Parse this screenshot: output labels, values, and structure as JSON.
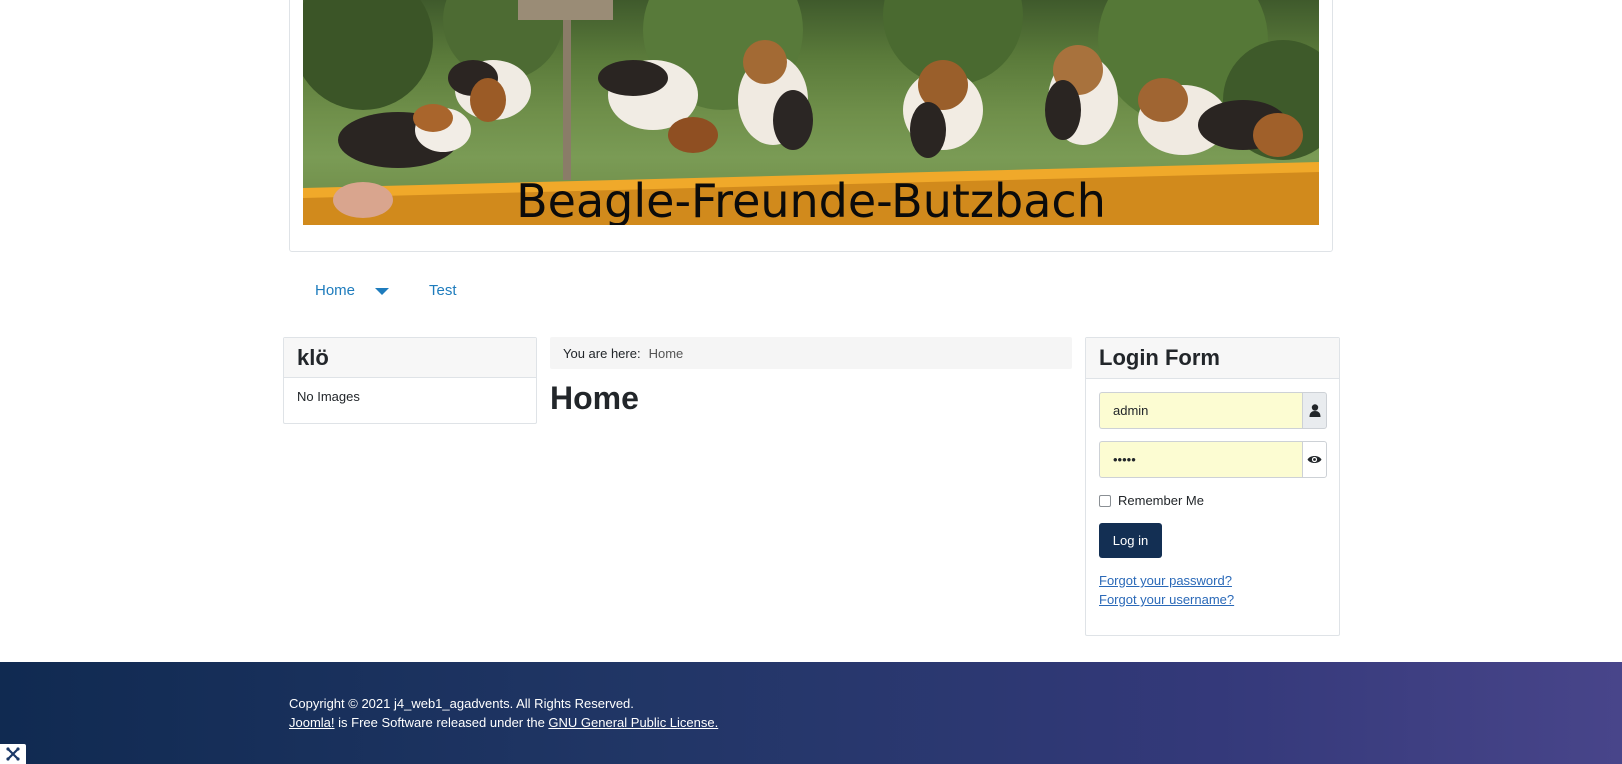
{
  "header": {
    "banner_title": "Beagle-Freunde-Butzbach"
  },
  "nav": {
    "items": [
      {
        "label": "Home"
      },
      {
        "label": "Test"
      }
    ]
  },
  "left_module": {
    "title": "klö",
    "body": "No Images"
  },
  "breadcrumb": {
    "prefix": "You are here:",
    "current": "Home"
  },
  "main": {
    "title": "Home"
  },
  "login": {
    "title": "Login Form",
    "username_value": "admin",
    "password_value": "•••••",
    "remember_label": "Remember Me",
    "login_button": "Log in",
    "forgot_password": "Forgot your password?",
    "forgot_username": "Forgot your username?"
  },
  "footer": {
    "copyright": "Copyright © 2021 j4_web1_agadvents. All Rights Reserved.",
    "joomla_link": "Joomla!",
    "middle_text": " is Free Software released under the ",
    "license_link": "GNU General Public License."
  },
  "colors": {
    "link": "#1e7cbd",
    "button": "#132f53",
    "input_bg": "#fcfcd2",
    "footer_start": "#102a51",
    "footer_end": "#48458a"
  },
  "icons": [
    "user-icon",
    "eye-icon",
    "chevron-down-icon",
    "joomla-icon"
  ]
}
